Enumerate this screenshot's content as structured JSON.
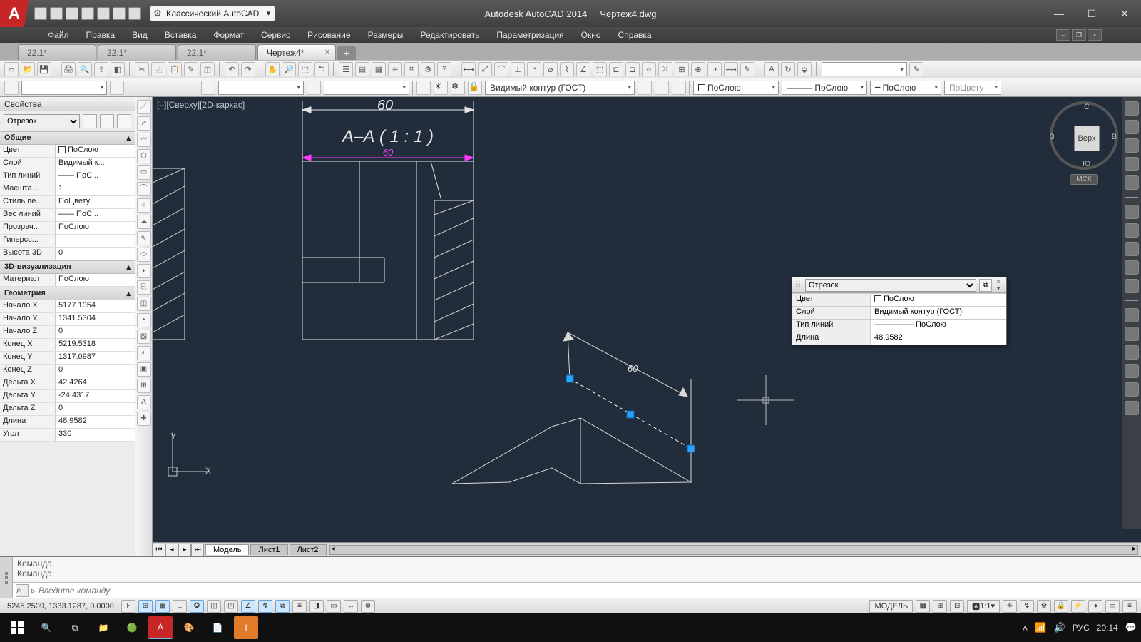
{
  "title": {
    "app": "Autodesk AutoCAD 2014",
    "file": "Чертеж4.dwg"
  },
  "workspace": "Классический AutoCAD",
  "menus": [
    "Файл",
    "Правка",
    "Вид",
    "Вставка",
    "Формат",
    "Сервис",
    "Рисование",
    "Размеры",
    "Редактировать",
    "Параметризация",
    "Окно",
    "Справка"
  ],
  "fileTabs": [
    {
      "label": "22.1*",
      "active": false
    },
    {
      "label": "22.1*",
      "active": false
    },
    {
      "label": "22.1*",
      "active": false
    },
    {
      "label": "Чертеж4*",
      "active": true
    }
  ],
  "layerCombo": "Видимый контур (ГОСТ)",
  "colorCombo": "ПоСлою",
  "ltypeCombo": "ПоСлою",
  "lweightCombo": "ПоСлою",
  "plotStyleCombo": "ПоЦвету",
  "viewLabel": "[–][Сверху][2D-каркас]",
  "section": {
    "dim": "60",
    "title": "А–А ( 1 : 1 )",
    "subdim": "60",
    "isoDim": "60"
  },
  "viewcube": {
    "n": "С",
    "s": "Ю",
    "e": "В",
    "w": "З",
    "face": "Верх",
    "wcs": "МСК"
  },
  "props": {
    "title": "Свойства",
    "objType": "Отрезок",
    "groups": {
      "general": {
        "name": "Общие",
        "rows": [
          [
            "Цвет",
            "ПоСлою"
          ],
          [
            "Слой",
            "Видимый к..."
          ],
          [
            "Тип линий",
            "—— ПоС..."
          ],
          [
            "Масшта...",
            "1"
          ],
          [
            "Стиль пе...",
            "ПоЦвету"
          ],
          [
            "Вес линий",
            "—— ПоС..."
          ],
          [
            "Прозрач...",
            "ПоСлою"
          ],
          [
            "Гиперсс...",
            ""
          ],
          [
            "Высота 3D",
            "0"
          ]
        ]
      },
      "viz3d": {
        "name": "3D-визуализация",
        "rows": [
          [
            "Материал",
            "ПоСлою"
          ]
        ]
      },
      "geom": {
        "name": "Геометрия",
        "rows": [
          [
            "Начало X",
            "5177.1054"
          ],
          [
            "Начало Y",
            "1341.5304"
          ],
          [
            "Начало Z",
            "0"
          ],
          [
            "Конец X",
            "5219.5318"
          ],
          [
            "Конец Y",
            "1317.0987"
          ],
          [
            "Конец Z",
            "0"
          ],
          [
            "Дельта X",
            "42.4264"
          ],
          [
            "Дельта Y",
            "-24.4317"
          ],
          [
            "Дельта Z",
            "0"
          ],
          [
            "Длина",
            "48.9582"
          ],
          [
            "Угол",
            "330"
          ]
        ]
      }
    }
  },
  "qprops": {
    "objType": "Отрезок",
    "rows": [
      [
        "Цвет",
        "ПоСлою"
      ],
      [
        "Слой",
        "Видимый контур (ГОСТ)"
      ],
      [
        "Тип линий",
        "————— ПоСлою"
      ],
      [
        "Длина",
        "48.9582"
      ]
    ]
  },
  "modelTabs": {
    "active": "Модель",
    "sheets": [
      "Лист1",
      "Лист2"
    ]
  },
  "cmd": {
    "hist1": "Команда:",
    "hist2": "Команда:",
    "placeholder": "Введите команду"
  },
  "status": {
    "coords": "5245.2509, 1333.1287, 0.0000",
    "model": "МОДЕЛЬ",
    "scale": "1:1"
  },
  "tray": {
    "lang": "РУС",
    "time": "20:14"
  }
}
